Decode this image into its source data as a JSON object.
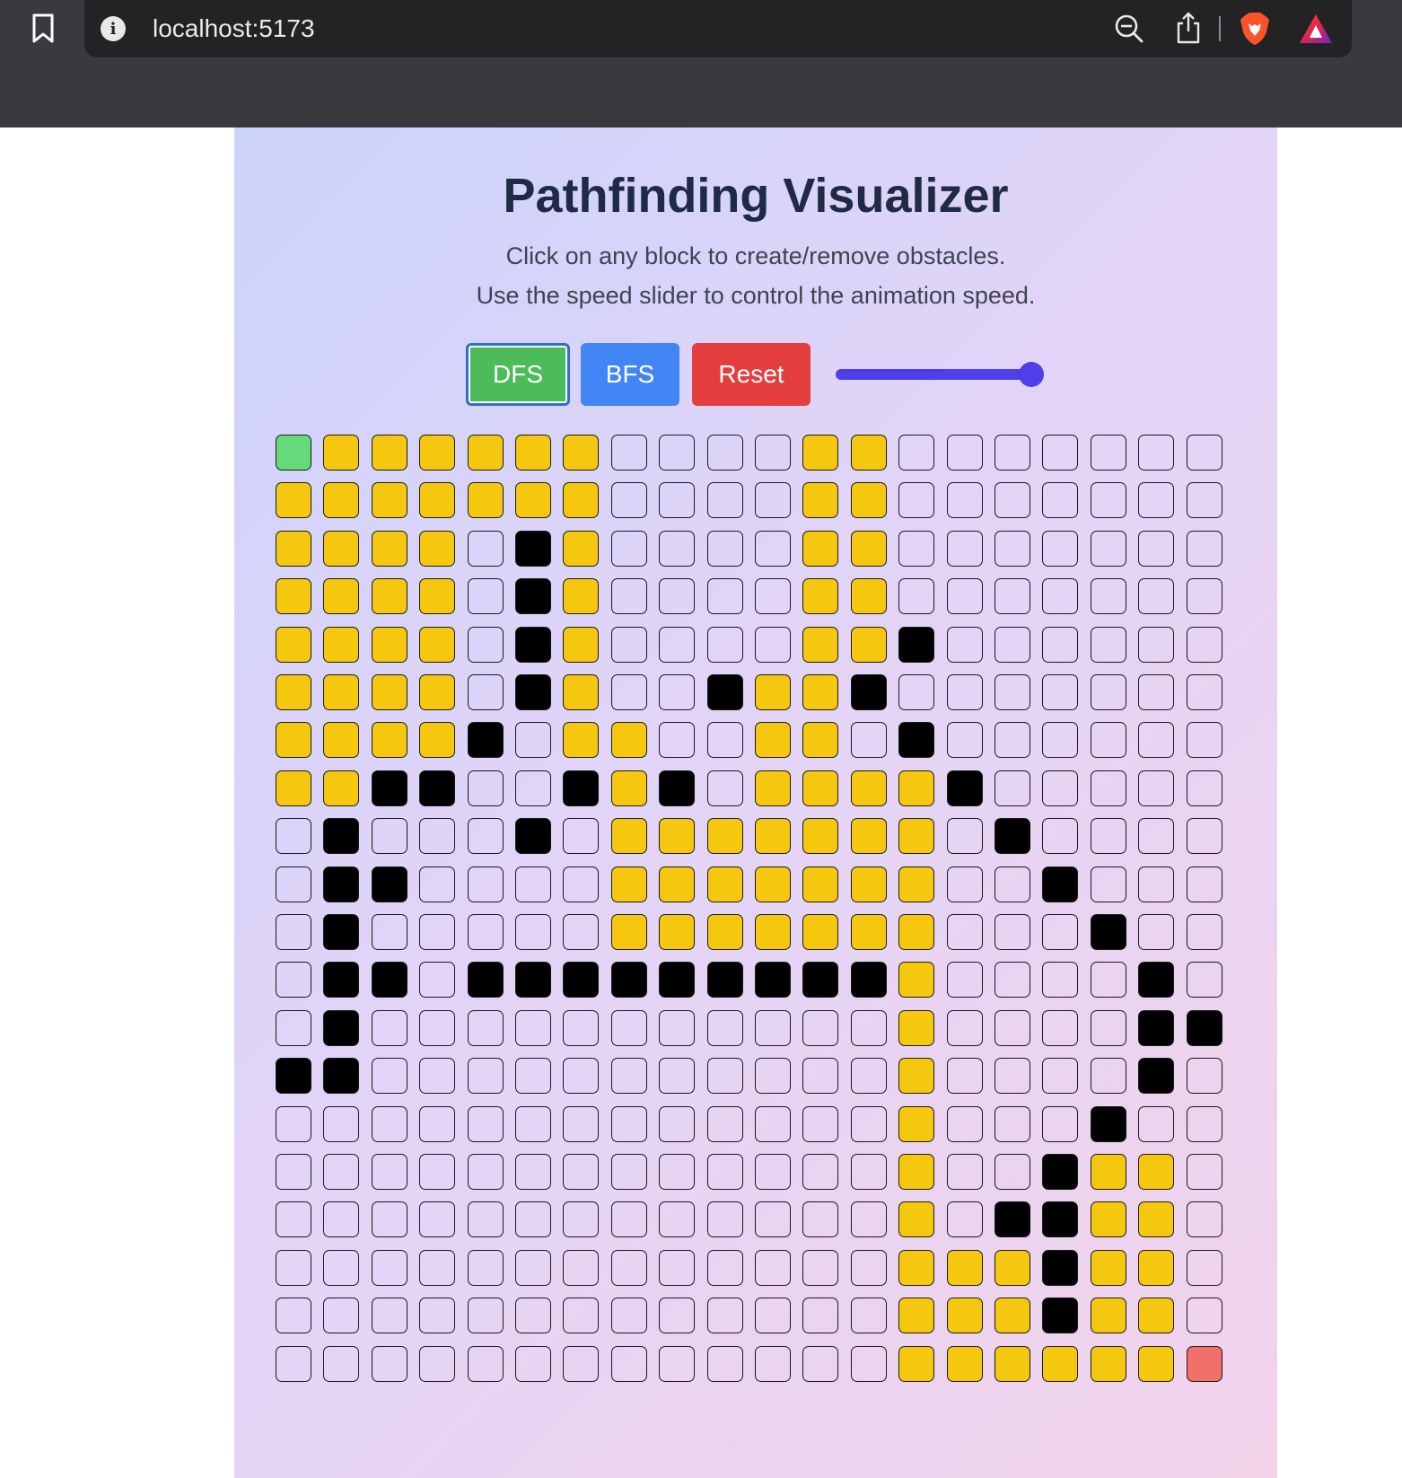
{
  "browser": {
    "url": "localhost:5173",
    "icons": [
      "bookmark-icon",
      "info-icon",
      "zoom-out-icon",
      "share-icon",
      "brave-shield-icon",
      "brave-rewards-icon"
    ],
    "chrome_color": "#3a3a3e"
  },
  "app": {
    "title": "Pathfinding Visualizer",
    "instructions": [
      "Click on any block to create/remove obstacles.",
      "Use the speed slider to control the animation speed."
    ],
    "buttons": {
      "dfs": "DFS",
      "bfs": "BFS",
      "reset": "Reset"
    },
    "active_algorithm": "DFS",
    "speed_slider_value": 1.0,
    "colors": {
      "visited": "#f5c70f",
      "wall": "#000000",
      "start": "#66d97a",
      "end": "#f2706a",
      "dfs_button": "#4cbb59",
      "bfs_button": "#4285f4",
      "reset_button": "#e53e3e",
      "slider": "#4f3fe8"
    },
    "grid": {
      "legend": "S = start, E = end, v = visited, # = wall, . = empty",
      "rows": [
        "Svvvvvv....vv.......",
        "vvvvvvv....vv.......",
        "vvvv.#v....vv.......",
        "vvvv.#v....vv.......",
        "vvvv.#v....vv#......",
        "vvvv.#v..#vv#.......",
        "vvvv#.vv..vv.#......",
        "vv##..#v#.vvvv#.....",
        ".#...#.vvvvvvv.#....",
        ".##....vvvvvvv..#...",
        ".#.....vvvvvvv...#..",
        ".##.#########v....#.",
        ".#...........v....##",
        "##...........v....#.",
        ".............v...#..",
        ".............v..#vv.",
        ".............v.##vv.",
        ".............vvv#vv.",
        ".............vvv#vv.",
        ".............vvvvvvE"
      ]
    }
  }
}
